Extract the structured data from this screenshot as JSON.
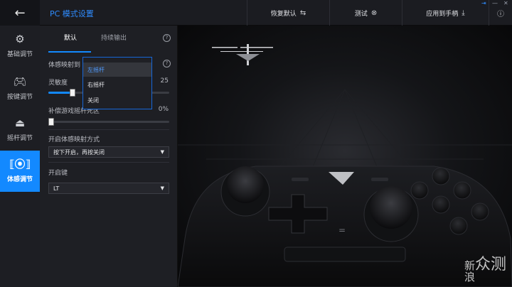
{
  "header": {
    "title": "PC 模式设置",
    "back_icon": "arrow-left-icon",
    "buttons": [
      {
        "label": "恢复默认",
        "icon": "reset-icon"
      },
      {
        "label": "测试",
        "icon": "target-icon"
      },
      {
        "label": "应用到手柄",
        "icon": "download-icon"
      }
    ],
    "info_icon": "info-icon"
  },
  "sidebar": {
    "items": [
      {
        "label": "基础调节",
        "icon": "gear-icon",
        "active": false
      },
      {
        "label": "按键调节",
        "icon": "gamepad-icon",
        "active": false
      },
      {
        "label": "摇杆调节",
        "icon": "joystick-icon",
        "active": false
      },
      {
        "label": "体感调节",
        "icon": "motion-sensor-icon",
        "active": true
      }
    ]
  },
  "panel": {
    "tabs": [
      {
        "label": "默认",
        "active": true
      },
      {
        "label": "持续输出",
        "active": false
      }
    ],
    "mapping_label": "体感映射到",
    "sensitivity": {
      "label": "灵敏度",
      "value": "25",
      "fraction": 0.2
    },
    "deadzone": {
      "label": "补偿游戏摇杆死区",
      "value": "0%",
      "fraction": 0.0
    },
    "enable_mode": {
      "label": "开启体感映射方式",
      "selected": "按下开启，再按关闭"
    },
    "enable_key": {
      "label": "开启键",
      "selected": "LT"
    }
  },
  "dropdown": {
    "options": [
      {
        "label": "左摇杆",
        "selected": true
      },
      {
        "label": "右摇杆",
        "selected": false
      },
      {
        "label": "关闭",
        "selected": false
      }
    ]
  },
  "watermark": {
    "line1": "新",
    "line2": "浪",
    "text": "众测"
  },
  "colors": {
    "accent": "#1389ff",
    "background": "#0e0e10",
    "panel": "#1e1f24"
  }
}
